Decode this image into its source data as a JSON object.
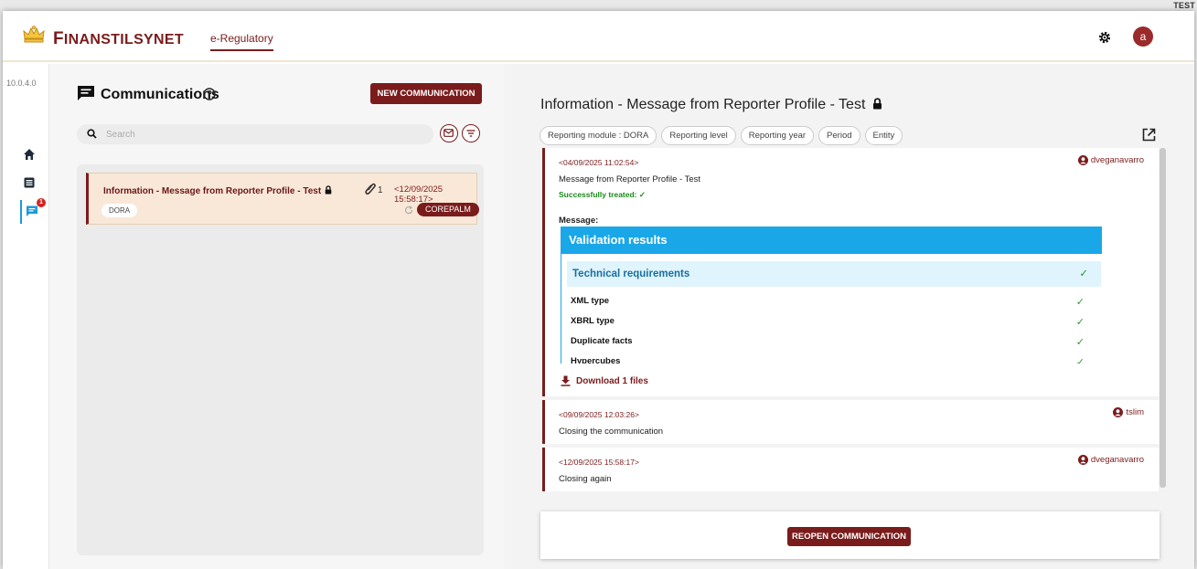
{
  "env_label": "TEST",
  "header": {
    "brand_first": "F",
    "brand_rest": "INANSTILSYNET",
    "app_tab": "e-Regulatory",
    "avatar_letter": "a"
  },
  "sidebar": {
    "version": "10.0.4.0",
    "items": [
      {
        "icon": "home-icon"
      },
      {
        "icon": "list-icon"
      },
      {
        "icon": "chat-icon",
        "badge": "1",
        "active": true
      }
    ]
  },
  "communications": {
    "title": "Communications",
    "new_button": "NEW COMMUNICATION",
    "search_placeholder": "Search",
    "items": [
      {
        "title": "Information - Message from Reporter Profile - Test",
        "attachments": "1",
        "date": "<12/09/2025 15:58:17>",
        "tag": "DORA",
        "owner": "COREPALM"
      }
    ]
  },
  "detail": {
    "title": "Information - Message from Reporter Profile - Test",
    "chips": [
      "Reporting module : DORA",
      "Reporting level",
      "Reporting year",
      "Period",
      "Entity"
    ],
    "messages": [
      {
        "date": "<04/09/2025 11:02:54>",
        "user": "dveganavarro",
        "text": "Message from Reporter Profile - Test",
        "status": "Successfully treated: ✓",
        "label": "Message:",
        "validation": {
          "title": "Validation results",
          "section": "Technical requirements",
          "section_status": "✓",
          "rows": [
            {
              "name": "XML type",
              "status": "✓"
            },
            {
              "name": "XBRL type",
              "status": "✓"
            },
            {
              "name": "Duplicate facts",
              "status": "✓"
            },
            {
              "name": "Hypercubes",
              "status": "✓"
            }
          ]
        },
        "download": "Download 1 files"
      },
      {
        "date": "<09/09/2025 12:03:26>",
        "user": "tslim",
        "text": "Closing the communication"
      },
      {
        "date": "<12/09/2025 15:58:17>",
        "user": "dveganavarro",
        "text": "Closing again"
      }
    ],
    "reopen_button": "REOPEN COMMUNICATION"
  },
  "colors": {
    "brand": "#7a1c1c",
    "accent": "#1aa7e8",
    "success": "#2a9a2a"
  }
}
